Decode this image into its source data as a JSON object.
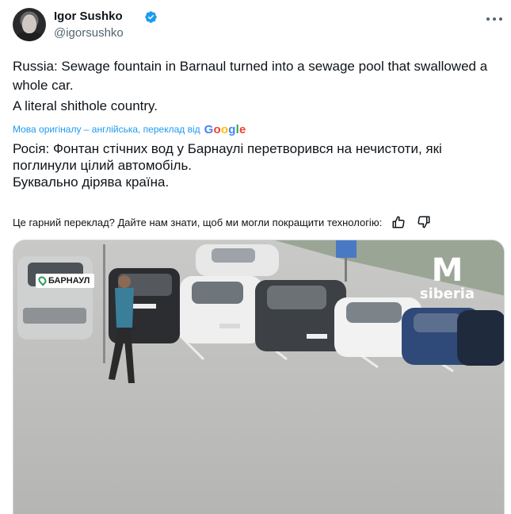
{
  "author": {
    "name": "Igor Sushko",
    "handle": "@igorsushko"
  },
  "tweet": {
    "original_lines": [
      "Russia: Sewage fountain in Barnaul turned into a sewage pool that swallowed a whole car.",
      "A literal shithole country."
    ],
    "translated_by_label": "Мова оригіналу – англійська, переклад від",
    "translator_logo_text": "Google",
    "translated_lines": [
      "Росія: Фонтан стічних вод у Барнаулі перетворився на нечистоти, які поглинули цілий автомобіль.",
      "Буквально дірява країна."
    ],
    "feedback_prompt": "Це гарний переклад? Дайте нам знати, щоб ми могли покращити технологію:"
  },
  "media": {
    "location_tag": "БАРНАУЛ",
    "watermark_letter": "M",
    "watermark_text": "siberia"
  },
  "colors": {
    "accent": "#1d9bf0",
    "verified_badge": "#1d9bf0",
    "secondary_text": "#536471"
  },
  "icons": {
    "verified": "verified-badge-icon",
    "more": "more-options-icon",
    "thumbs_up": "thumbs-up-icon",
    "thumbs_down": "thumbs-down-icon",
    "location": "location-pin-icon"
  }
}
